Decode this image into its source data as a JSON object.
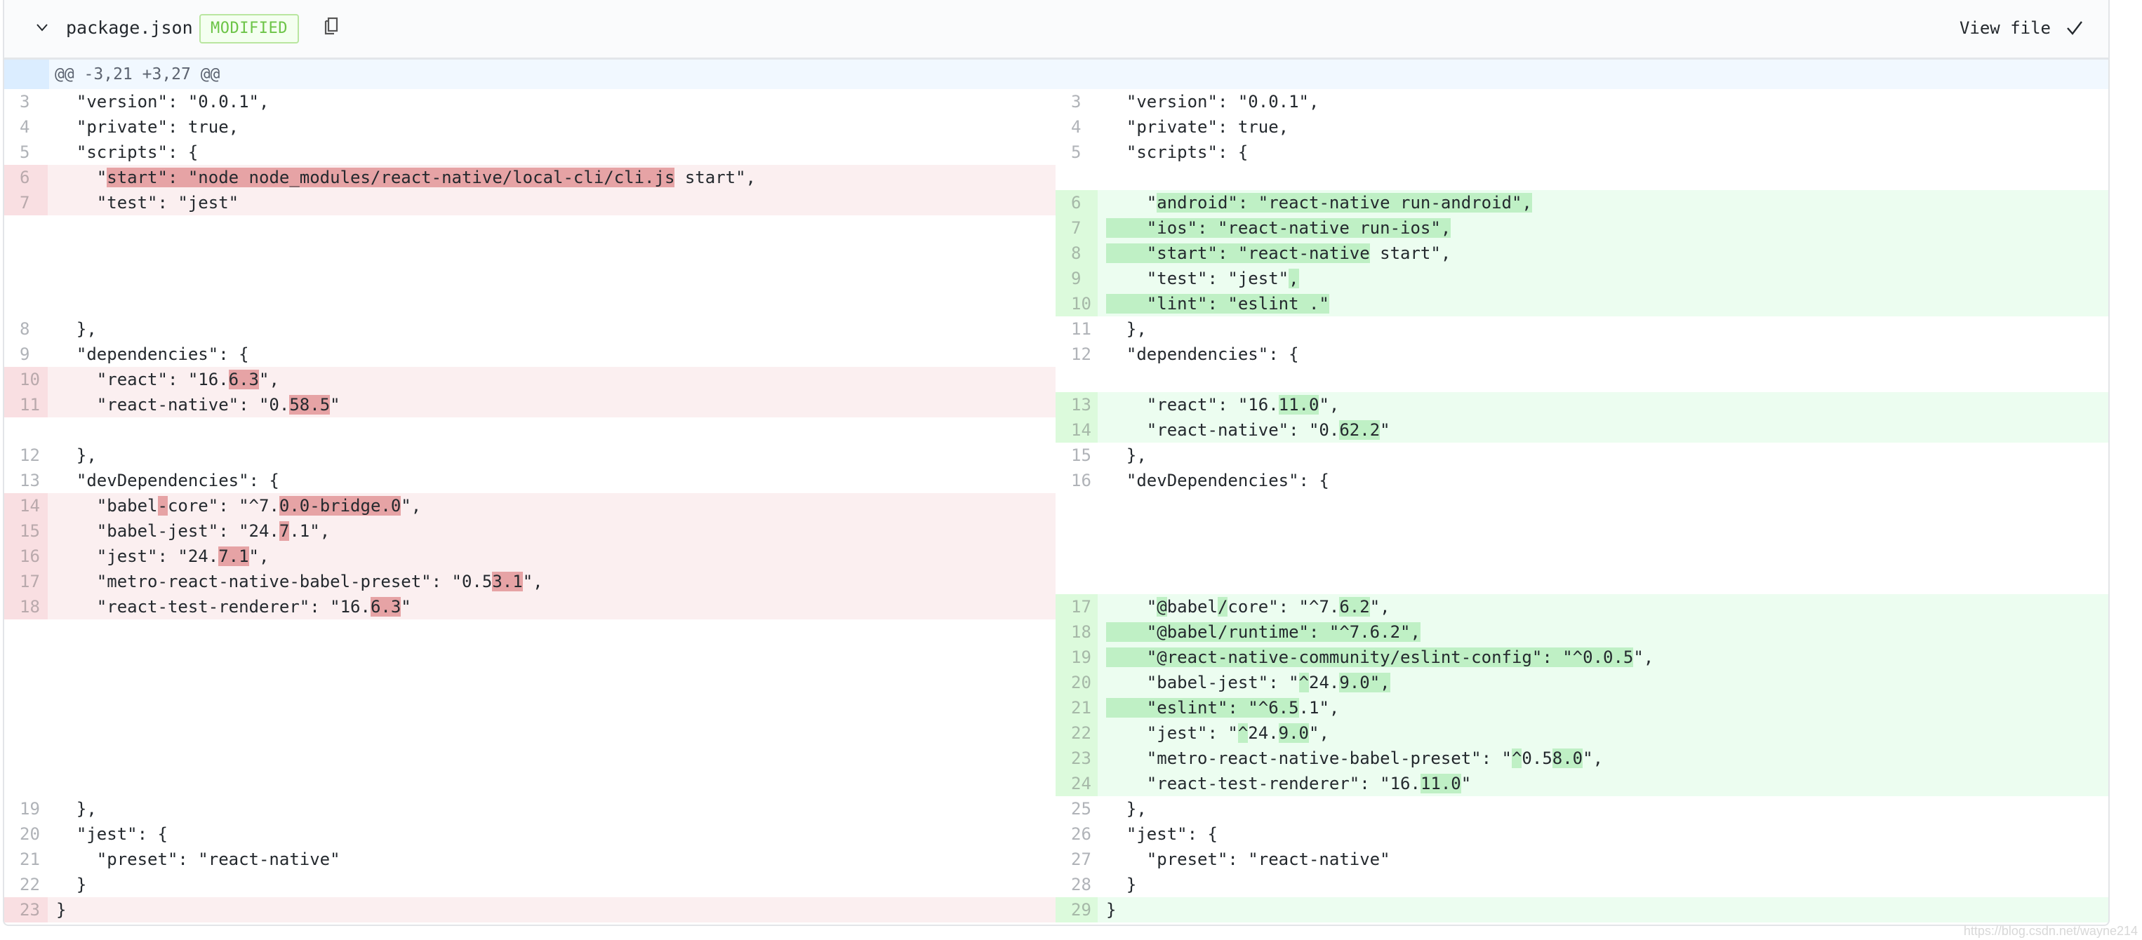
{
  "header": {
    "file_name": "package.json",
    "status_badge": "MODIFIED",
    "view_file_label": "View file",
    "icons": {
      "collapse": "chevron-down-icon",
      "copy": "copy-path-icon",
      "viewed": "check-icon"
    }
  },
  "hunk": {
    "header": "@@ -3,21 +3,27 @@"
  },
  "colors": {
    "deletion_line": "#fbeff0",
    "deletion_highlight": "#e6a3a5",
    "addition_line": "#ecfdf0",
    "addition_highlight": "#bff0c5",
    "badge_text": "#6cc447"
  },
  "left_lines": [
    {
      "type": "ctx",
      "num": "3",
      "segs": [
        [
          "  \"version\": \"0.0.1\",",
          0
        ]
      ]
    },
    {
      "type": "ctx",
      "num": "4",
      "segs": [
        [
          "  \"private\": true,",
          0
        ]
      ]
    },
    {
      "type": "ctx",
      "num": "5",
      "segs": [
        [
          "  \"scripts\": {",
          0
        ]
      ]
    },
    {
      "type": "del",
      "num": "6",
      "segs": [
        [
          "    \"",
          0
        ],
        [
          "start\": \"node node_modules/react-native/local-cli/cli.js",
          1
        ],
        [
          " start\",",
          0
        ]
      ]
    },
    {
      "type": "del",
      "num": "7",
      "segs": [
        [
          "    \"test\": \"jest\"",
          0
        ]
      ]
    },
    {
      "type": "blank"
    },
    {
      "type": "blank"
    },
    {
      "type": "blank"
    },
    {
      "type": "blank"
    },
    {
      "type": "ctx",
      "num": "8",
      "segs": [
        [
          "  },",
          0
        ]
      ]
    },
    {
      "type": "ctx",
      "num": "9",
      "segs": [
        [
          "  \"dependencies\": {",
          0
        ]
      ]
    },
    {
      "type": "del",
      "num": "10",
      "segs": [
        [
          "    \"react\": \"16.",
          0
        ],
        [
          "6.3",
          1
        ],
        [
          "\",",
          0
        ]
      ]
    },
    {
      "type": "del",
      "num": "11",
      "segs": [
        [
          "    \"react-native\": \"0.",
          0
        ],
        [
          "58.5",
          1
        ],
        [
          "\"",
          0
        ]
      ]
    },
    {
      "type": "blank"
    },
    {
      "type": "ctx",
      "num": "12",
      "segs": [
        [
          "  },",
          0
        ]
      ]
    },
    {
      "type": "ctx",
      "num": "13",
      "segs": [
        [
          "  \"devDependencies\": {",
          0
        ]
      ]
    },
    {
      "type": "del",
      "num": "14",
      "segs": [
        [
          "    \"babel",
          0
        ],
        [
          "-",
          1
        ],
        [
          "core\": \"^7.",
          0
        ],
        [
          "0.0-bridge.0",
          1
        ],
        [
          "\",",
          0
        ]
      ]
    },
    {
      "type": "del",
      "num": "15",
      "segs": [
        [
          "    \"babel-jest\": \"24.",
          0
        ],
        [
          "7",
          1
        ],
        [
          ".1\",",
          0
        ]
      ]
    },
    {
      "type": "del",
      "num": "16",
      "segs": [
        [
          "    \"jest\": \"24.",
          0
        ],
        [
          "7.1",
          1
        ],
        [
          "\",",
          0
        ]
      ]
    },
    {
      "type": "del",
      "num": "17",
      "segs": [
        [
          "    \"metro-react-native-babel-preset\": \"0.5",
          0
        ],
        [
          "3.1",
          1
        ],
        [
          "\",",
          0
        ]
      ]
    },
    {
      "type": "del",
      "num": "18",
      "segs": [
        [
          "    \"react-test-renderer\": \"16.",
          0
        ],
        [
          "6.3",
          1
        ],
        [
          "\"",
          0
        ]
      ]
    },
    {
      "type": "blank"
    },
    {
      "type": "blank"
    },
    {
      "type": "blank"
    },
    {
      "type": "blank"
    },
    {
      "type": "blank"
    },
    {
      "type": "blank"
    },
    {
      "type": "blank"
    },
    {
      "type": "ctx",
      "num": "19",
      "segs": [
        [
          "  },",
          0
        ]
      ]
    },
    {
      "type": "ctx",
      "num": "20",
      "segs": [
        [
          "  \"jest\": {",
          0
        ]
      ]
    },
    {
      "type": "ctx",
      "num": "21",
      "segs": [
        [
          "    \"preset\": \"react-native\"",
          0
        ]
      ]
    },
    {
      "type": "ctx",
      "num": "22",
      "segs": [
        [
          "  }",
          0
        ]
      ]
    },
    {
      "type": "del",
      "num": "23",
      "segs": [
        [
          "}",
          0
        ]
      ]
    }
  ],
  "right_lines": [
    {
      "type": "ctx",
      "num": "3",
      "segs": [
        [
          "  \"version\": \"0.0.1\",",
          0
        ]
      ]
    },
    {
      "type": "ctx",
      "num": "4",
      "segs": [
        [
          "  \"private\": true,",
          0
        ]
      ]
    },
    {
      "type": "ctx",
      "num": "5",
      "segs": [
        [
          "  \"scripts\": {",
          0
        ]
      ]
    },
    {
      "type": "blank"
    },
    {
      "type": "add",
      "num": "6",
      "segs": [
        [
          "    \"",
          0
        ],
        [
          "android\": \"react-native run-android\",",
          1
        ]
      ]
    },
    {
      "type": "add",
      "num": "7",
      "segs": [
        [
          "    \"ios\": \"react-native run-ios\",",
          1
        ]
      ]
    },
    {
      "type": "add",
      "num": "8",
      "segs": [
        [
          "    \"start\": \"react-native",
          1
        ],
        [
          " start\",",
          0
        ]
      ]
    },
    {
      "type": "add",
      "num": "9",
      "segs": [
        [
          "    \"test\": \"jest\"",
          0
        ],
        [
          ",",
          1
        ]
      ]
    },
    {
      "type": "add",
      "num": "10",
      "segs": [
        [
          "    \"lint\": \"eslint .\"",
          1
        ]
      ]
    },
    {
      "type": "ctx",
      "num": "11",
      "segs": [
        [
          "  },",
          0
        ]
      ]
    },
    {
      "type": "ctx",
      "num": "12",
      "segs": [
        [
          "  \"dependencies\": {",
          0
        ]
      ]
    },
    {
      "type": "blank"
    },
    {
      "type": "add",
      "num": "13",
      "segs": [
        [
          "    \"react\": \"16.",
          0
        ],
        [
          "11.0",
          1
        ],
        [
          "\",",
          0
        ]
      ]
    },
    {
      "type": "add",
      "num": "14",
      "segs": [
        [
          "    \"react-native\": \"0.",
          0
        ],
        [
          "62.2",
          1
        ],
        [
          "\"",
          0
        ]
      ]
    },
    {
      "type": "ctx",
      "num": "15",
      "segs": [
        [
          "  },",
          0
        ]
      ]
    },
    {
      "type": "ctx",
      "num": "16",
      "segs": [
        [
          "  \"devDependencies\": {",
          0
        ]
      ]
    },
    {
      "type": "blank"
    },
    {
      "type": "blank"
    },
    {
      "type": "blank"
    },
    {
      "type": "blank"
    },
    {
      "type": "add",
      "num": "17",
      "segs": [
        [
          "    \"",
          0
        ],
        [
          "@",
          1
        ],
        [
          "babel",
          0
        ],
        [
          "/",
          1
        ],
        [
          "core\": \"^7.",
          0
        ],
        [
          "6.2",
          1
        ],
        [
          "\",",
          0
        ]
      ]
    },
    {
      "type": "add",
      "num": "18",
      "segs": [
        [
          "    \"@babel/runtime\": \"^7.6.2\",",
          1
        ]
      ]
    },
    {
      "type": "add",
      "num": "19",
      "segs": [
        [
          "    \"@react-native-community/eslint-config\": \"^0.0.5",
          1
        ],
        [
          "\",",
          0
        ]
      ]
    },
    {
      "type": "add",
      "num": "20",
      "segs": [
        [
          "    \"babel-jest\": \"",
          0
        ],
        [
          "^",
          1
        ],
        [
          "24.",
          0
        ],
        [
          "9.0\",",
          1
        ]
      ]
    },
    {
      "type": "add",
      "num": "21",
      "segs": [
        [
          "    \"eslint\": \"^6.5",
          1
        ],
        [
          ".1\",",
          0
        ]
      ]
    },
    {
      "type": "add",
      "num": "22",
      "segs": [
        [
          "    \"jest\": \"",
          0
        ],
        [
          "^",
          1
        ],
        [
          "24.",
          0
        ],
        [
          "9.0",
          1
        ],
        [
          "\",",
          0
        ]
      ]
    },
    {
      "type": "add",
      "num": "23",
      "segs": [
        [
          "    \"metro-react-native-babel-preset\": \"",
          0
        ],
        [
          "^",
          1
        ],
        [
          "0.5",
          0
        ],
        [
          "8.0",
          1
        ],
        [
          "\",",
          0
        ]
      ]
    },
    {
      "type": "add",
      "num": "24",
      "segs": [
        [
          "    \"react-test-renderer\": \"16.",
          0
        ],
        [
          "11.0",
          1
        ],
        [
          "\"",
          0
        ]
      ]
    },
    {
      "type": "ctx",
      "num": "25",
      "segs": [
        [
          "  },",
          0
        ]
      ]
    },
    {
      "type": "ctx",
      "num": "26",
      "segs": [
        [
          "  \"jest\": {",
          0
        ]
      ]
    },
    {
      "type": "ctx",
      "num": "27",
      "segs": [
        [
          "    \"preset\": \"react-native\"",
          0
        ]
      ]
    },
    {
      "type": "ctx",
      "num": "28",
      "segs": [
        [
          "  }",
          0
        ]
      ]
    },
    {
      "type": "add",
      "num": "29",
      "segs": [
        [
          "}",
          0
        ]
      ]
    }
  ],
  "watermark": "https://blog.csdn.net/wayne214"
}
